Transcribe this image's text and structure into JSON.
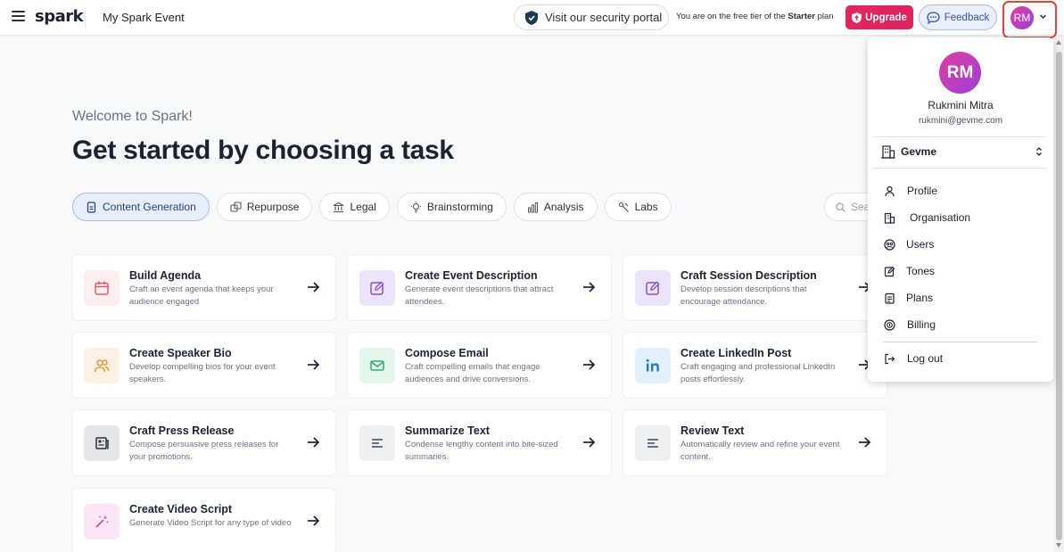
{
  "header": {
    "logo_text": "spark",
    "event_name": "My Spark Event",
    "security_label": "Visit our security portal",
    "tier_prefix": "You are on the free tier of the",
    "tier_plan": "Starter",
    "tier_suffix": "plan",
    "upgrade_label": "Upgrade",
    "feedback_label": "Feedback",
    "avatar_initials": "RM"
  },
  "main": {
    "welcome": "Welcome to Spark!",
    "headline": "Get started by choosing a task",
    "tabs": [
      {
        "label": "Content Generation",
        "icon": "document-icon",
        "active": true
      },
      {
        "label": "Repurpose",
        "icon": "repurpose-icon",
        "active": false
      },
      {
        "label": "Legal",
        "icon": "bank-icon",
        "active": false
      },
      {
        "label": "Brainstorming",
        "icon": "lightbulb-icon",
        "active": false
      },
      {
        "label": "Analysis",
        "icon": "chart-icon",
        "active": false
      },
      {
        "label": "Labs",
        "icon": "labs-icon",
        "active": false
      }
    ],
    "search_placeholder": "Sea"
  },
  "cards": [
    {
      "title": "Build Agenda",
      "desc": "Craft an event agenda that keeps your audience engaged",
      "icon": "calendar-icon"
    },
    {
      "title": "Create Event Description",
      "desc": "Generate event descriptions that attract attendees.",
      "icon": "edit-icon"
    },
    {
      "title": "Craft Session Description",
      "desc": "Develop session descriptions that encourage attendance.",
      "icon": "edit-icon"
    },
    {
      "title": "Create Speaker Bio",
      "desc": "Develop compelling bios for your event speakers.",
      "icon": "people-icon"
    },
    {
      "title": "Compose Email",
      "desc": "Craft compelling emails that engage audiences and drive conversions.",
      "icon": "mail-icon"
    },
    {
      "title": "Create LinkedIn Post",
      "desc": "Craft engaging and professional LinkedIn posts effortlessly.",
      "icon": "linkedin-icon"
    },
    {
      "title": "Craft Press Release",
      "desc": "Compose persuasive press releases for your promotions.",
      "icon": "newspaper-icon"
    },
    {
      "title": "Summarize Text",
      "desc": "Condense lengthy content into bite-sized summaries.",
      "icon": "align-left-icon"
    },
    {
      "title": "Review Text",
      "desc": "Automatically review and refine your event content.",
      "icon": "align-left-icon"
    },
    {
      "title": "Create Video Script",
      "desc": "Generate Video Script for any type of video",
      "icon": "magic-wand-icon"
    }
  ],
  "dropdown": {
    "avatar_initials": "RM",
    "name": "Rukmini Mitra",
    "email": "rukmini@gevme.com",
    "org_name": "Gevme",
    "items": [
      {
        "label": "Profile",
        "icon": "user-icon"
      },
      {
        "label": "Organisation",
        "icon": "organisation-icon"
      },
      {
        "label": "Users",
        "icon": "users-icon"
      },
      {
        "label": "Tones",
        "icon": "tones-icon"
      },
      {
        "label": "Plans",
        "icon": "plans-icon"
      },
      {
        "label": "Billing",
        "icon": "billing-icon"
      }
    ],
    "logout_label": "Log out"
  },
  "colors": {
    "accent_pink": "#e0245e",
    "feedback_blue": "#3753b6",
    "active_tab_bg": "#e8eefb",
    "highlight_border": "#d94a3a"
  }
}
